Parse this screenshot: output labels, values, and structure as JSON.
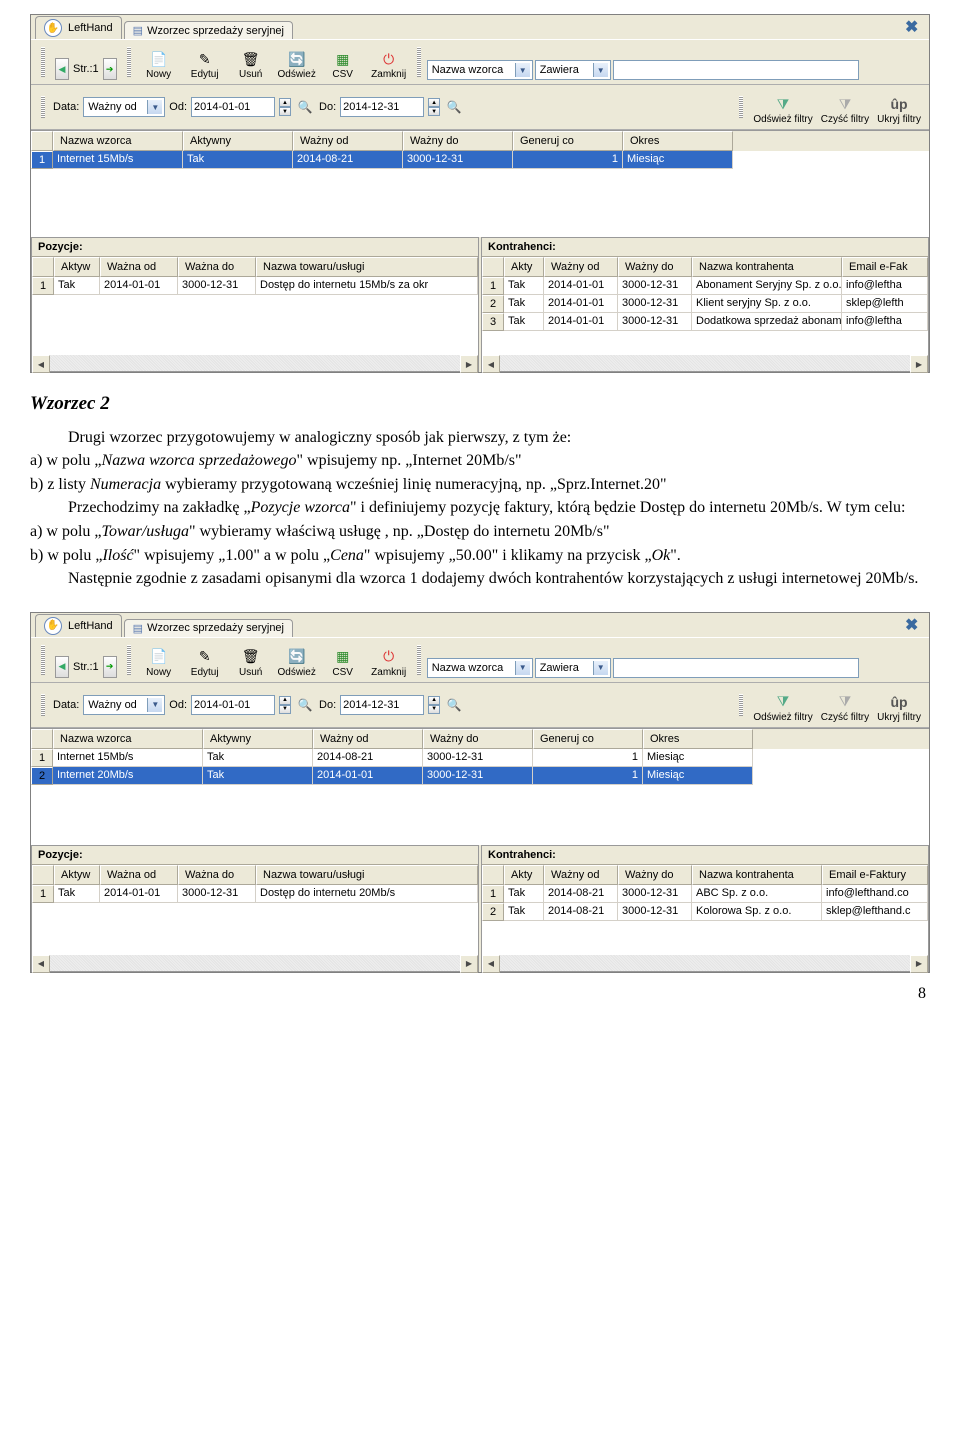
{
  "tabs": {
    "left": "LeftHand",
    "main": "Wzorzec sprzedaży seryjnej"
  },
  "pager_label": "Str.:1",
  "toolbar": {
    "nowy": "Nowy",
    "edytuj": "Edytuj",
    "usun": "Usuń",
    "odswiez": "Odśwież",
    "csv": "CSV",
    "zamknij": "Zamknij"
  },
  "search": {
    "field_label": "Nazwa wzorca",
    "op": "Zawiera"
  },
  "filter": {
    "data_label": "Data:",
    "data_combo": "Ważny od",
    "od_label": "Od:",
    "od": "2014-01-01",
    "do_label": "Do:",
    "do": "2014-12-31"
  },
  "filter_btns": {
    "odswiez": "Odśwież filtry",
    "czysc": "Czyść filtry",
    "ukryj": "Ukryj filtry"
  },
  "grid1": {
    "headers": [
      "",
      "Nazwa wzorca",
      "Aktywny",
      "Ważny od",
      "Ważny do",
      "Generuj co",
      "Okres"
    ],
    "rows": [
      [
        "1",
        "Internet 15Mb/s",
        "Tak",
        "2014-08-21",
        "3000-12-31",
        "1",
        "Miesiąc"
      ]
    ]
  },
  "pozycje": {
    "title": "Pozycje:",
    "headers": [
      "",
      "Aktyw",
      "Ważna od",
      "Ważna do",
      "Nazwa towaru/usługi"
    ],
    "rows": [
      [
        "1",
        "Tak",
        "2014-01-01",
        "3000-12-31",
        "Dostęp do internetu 15Mb/s za okr"
      ]
    ]
  },
  "kontrahenci": {
    "title": "Kontrahenci:",
    "headers": [
      "",
      "Akty",
      "Ważny od",
      "Ważny do",
      "Nazwa kontrahenta",
      "Email e-Fak"
    ],
    "rows": [
      [
        "1",
        "Tak",
        "2014-01-01",
        "3000-12-31",
        "Abonament Seryjny Sp. z o.o.",
        "info@leftha"
      ],
      [
        "2",
        "Tak",
        "2014-01-01",
        "3000-12-31",
        "Klient seryjny Sp. z o.o.",
        "sklep@lefth"
      ],
      [
        "3",
        "Tak",
        "2014-01-01",
        "3000-12-31",
        "Dodatkowa sprzedaż abonamę",
        "info@leftha"
      ]
    ]
  },
  "doc": {
    "title": "Wzorzec 2",
    "p1a": "Drugi wzorzec przygotowujemy w analogiczny sposób jak pierwszy, z tym że:",
    "p2": "a) w polu „Nazwa wzorca sprzedażowego\" wpisujemy np. „Internet 20Mb/s\"",
    "p3": "b) z listy Numeracja wybieramy przygotowaną wcześniej linię numeracyjną, np. „Sprz.Internet.20\"",
    "p4": "Przechodzimy na zakładkę „Pozycje wzorca\" i definiujemy pozycję faktury, którą będzie Dostęp do internetu 20Mb/s. W tym celu:",
    "p5": "a) w polu „Towar/usługa\" wybieramy właściwą usługę, np. „Dostęp do internetu 20Mb/s\"",
    "p6": "b) w polu „Ilość\" wpisujemy „1.00\" a w polu „Cena\" wpisujemy „50.00\" i klikamy na przycisk „Ok\".",
    "p7": "Następnie zgodnie z zasadami opisanymi dla wzorca 1 dodajemy dwóch kontrahentów korzystających z usługi internetowej 20Mb/s."
  },
  "grid2": {
    "headers": [
      "",
      "Nazwa wzorca",
      "Aktywny",
      "Ważny od",
      "Ważny do",
      "Generuj co",
      "Okres"
    ],
    "rows": [
      [
        "1",
        "Internet 15Mb/s",
        "Tak",
        "2014-08-21",
        "3000-12-31",
        "1",
        "Miesiąc"
      ],
      [
        "2",
        "Internet 20Mb/s",
        "Tak",
        "2014-01-01",
        "3000-12-31",
        "1",
        "Miesiąc"
      ]
    ]
  },
  "pozycje2": {
    "title": "Pozycje:",
    "headers": [
      "",
      "Aktyw",
      "Ważna od",
      "Ważna do",
      "Nazwa towaru/usługi"
    ],
    "rows": [
      [
        "1",
        "Tak",
        "2014-01-01",
        "3000-12-31",
        "Dostęp do internetu 20Mb/s"
      ]
    ]
  },
  "kontrahenci2": {
    "title": "Kontrahenci:",
    "headers": [
      "",
      "Akty",
      "Ważny od",
      "Ważny do",
      "Nazwa kontrahenta",
      "Email e-Faktury"
    ],
    "rows": [
      [
        "1",
        "Tak",
        "2014-08-21",
        "3000-12-31",
        "ABC Sp. z o.o.",
        "info@lefthand.co"
      ],
      [
        "2",
        "Tak",
        "2014-08-21",
        "3000-12-31",
        "Kolorowa Sp. z o.o.",
        "sklep@lefthand.c"
      ]
    ]
  },
  "page_number": "8"
}
